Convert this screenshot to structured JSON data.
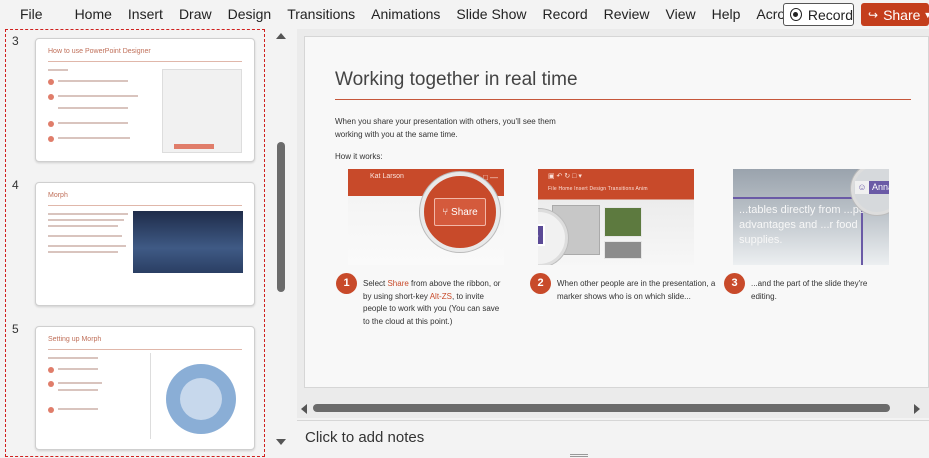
{
  "menu": {
    "items": [
      "File",
      "Home",
      "Insert",
      "Draw",
      "Design",
      "Transitions",
      "Animations",
      "Slide Show",
      "Record",
      "Review",
      "View",
      "Help",
      "Acrobat"
    ],
    "record_label": "Record",
    "share_label": "Share"
  },
  "thumbnails": [
    {
      "number": "3",
      "title": "How to use PowerPoint Designer"
    },
    {
      "number": "4",
      "title": "Morph"
    },
    {
      "number": "5",
      "title": "Setting up Morph"
    }
  ],
  "slide": {
    "title": "Working together in real time",
    "intro": "When you share your presentation with others, you'll see them working with you at the same time.",
    "how_it_works": "How it works:",
    "pic1": {
      "user_name": "Kat Larson",
      "share_label": "Share"
    },
    "pic2": {
      "tabs": "File   Home   Insert   Design   Transitions   Anim"
    },
    "pic3": {
      "text": "...tables directly from ...per of advantages and ...r food supplies.",
      "user": "Anna"
    },
    "steps": [
      {
        "number": "1",
        "text_before": "Select ",
        "highlight": "Share",
        "text_mid": " from above the ribbon, or by using short-key ",
        "highlight2": "Alt-ZS",
        "text_after": ", to invite people to work with you (You can save to the cloud at this point.)"
      },
      {
        "number": "2",
        "text": "When other people are in the presentation, a marker shows who is on which slide..."
      },
      {
        "number": "3",
        "text": "...and the part of the slide they're editing."
      }
    ]
  },
  "notes": {
    "placeholder": "Click to add notes"
  },
  "colors": {
    "accent": "#c84a2a",
    "share_button": "#c43e1c",
    "selection_border": "#d0201e"
  },
  "icons": [
    "record-icon",
    "share-icon",
    "scroll-up-icon",
    "scroll-down-icon",
    "scroll-left-icon",
    "scroll-right-icon",
    "user-avatar-icon"
  ]
}
